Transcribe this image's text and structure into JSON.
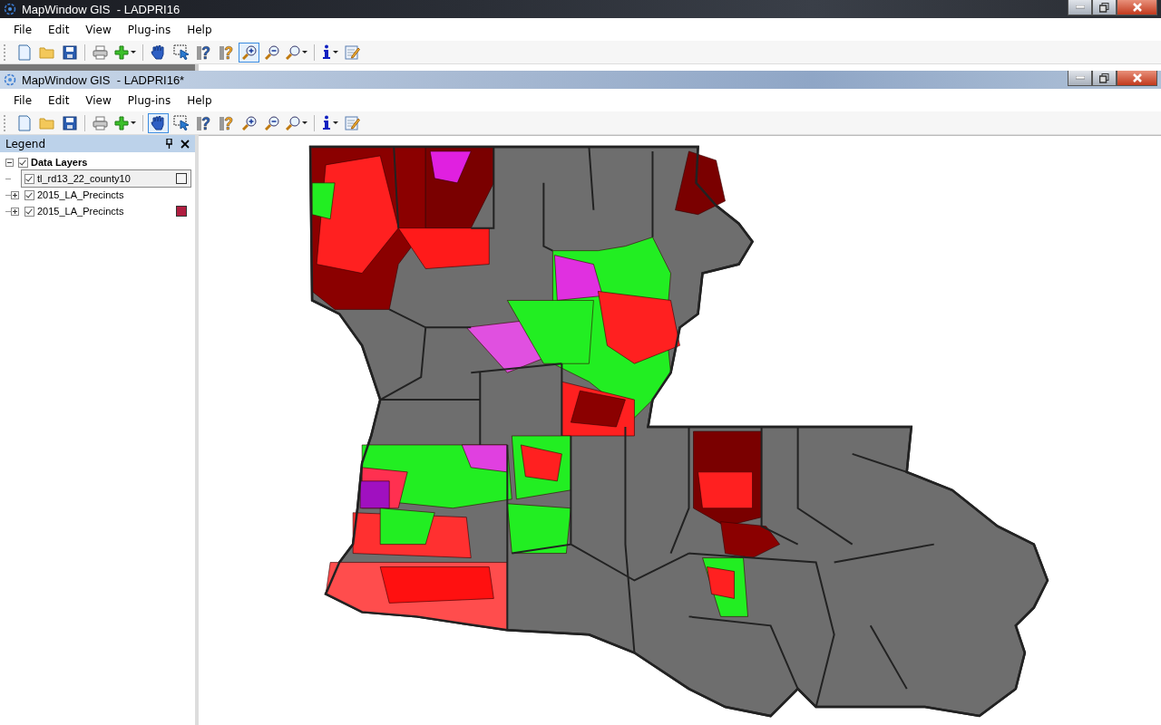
{
  "windows": [
    {
      "title": "MapWindow GIS  - LADPRI16",
      "menu": [
        "File",
        "Edit",
        "View",
        "Plug-ins",
        "Help"
      ],
      "toolbar": [
        {
          "kind": "new",
          "selected": false
        },
        {
          "kind": "open",
          "selected": false
        },
        {
          "kind": "save",
          "selected": false
        },
        {
          "kind": "sep"
        },
        {
          "kind": "print",
          "selected": false
        },
        {
          "kind": "add",
          "selected": false
        },
        {
          "kind": "sep"
        },
        {
          "kind": "pan",
          "selected": false
        },
        {
          "kind": "select",
          "selected": false
        },
        {
          "kind": "identify",
          "selected": false
        },
        {
          "kind": "query",
          "selected": false
        },
        {
          "kind": "zoomin",
          "selected": true
        },
        {
          "kind": "zoomout",
          "selected": false
        },
        {
          "kind": "zoom",
          "selected": false
        },
        {
          "kind": "sep"
        },
        {
          "kind": "info",
          "selected": false
        },
        {
          "kind": "edit",
          "selected": false
        }
      ]
    },
    {
      "title": "MapWindow GIS  - LADPRI16*",
      "menu": [
        "File",
        "Edit",
        "View",
        "Plug-ins",
        "Help"
      ],
      "toolbar": [
        {
          "kind": "new",
          "selected": false
        },
        {
          "kind": "open",
          "selected": false
        },
        {
          "kind": "save",
          "selected": false
        },
        {
          "kind": "sep"
        },
        {
          "kind": "print",
          "selected": false
        },
        {
          "kind": "add",
          "selected": false
        },
        {
          "kind": "sep"
        },
        {
          "kind": "pan",
          "selected": true
        },
        {
          "kind": "select",
          "selected": false
        },
        {
          "kind": "identify",
          "selected": false
        },
        {
          "kind": "query",
          "selected": false
        },
        {
          "kind": "zoomin",
          "selected": false
        },
        {
          "kind": "zoomout",
          "selected": false
        },
        {
          "kind": "zoom",
          "selected": false
        },
        {
          "kind": "sep"
        },
        {
          "kind": "info",
          "selected": false
        },
        {
          "kind": "edit",
          "selected": false
        }
      ]
    }
  ],
  "legend": {
    "title": "Legend",
    "group": {
      "label": "Data Layers",
      "checked": true,
      "expanded": true,
      "layers": [
        {
          "label": "tl_rd13_22_county10",
          "checked": true,
          "selected": true,
          "expandable": false,
          "color": "#f4f4f4"
        },
        {
          "label": "2015_LA_Precincts",
          "checked": true,
          "selected": false,
          "expandable": true
        },
        {
          "label": "2015_LA_Precincts",
          "checked": true,
          "selected": false,
          "expandable": true,
          "color": "#b01e40"
        }
      ]
    }
  }
}
